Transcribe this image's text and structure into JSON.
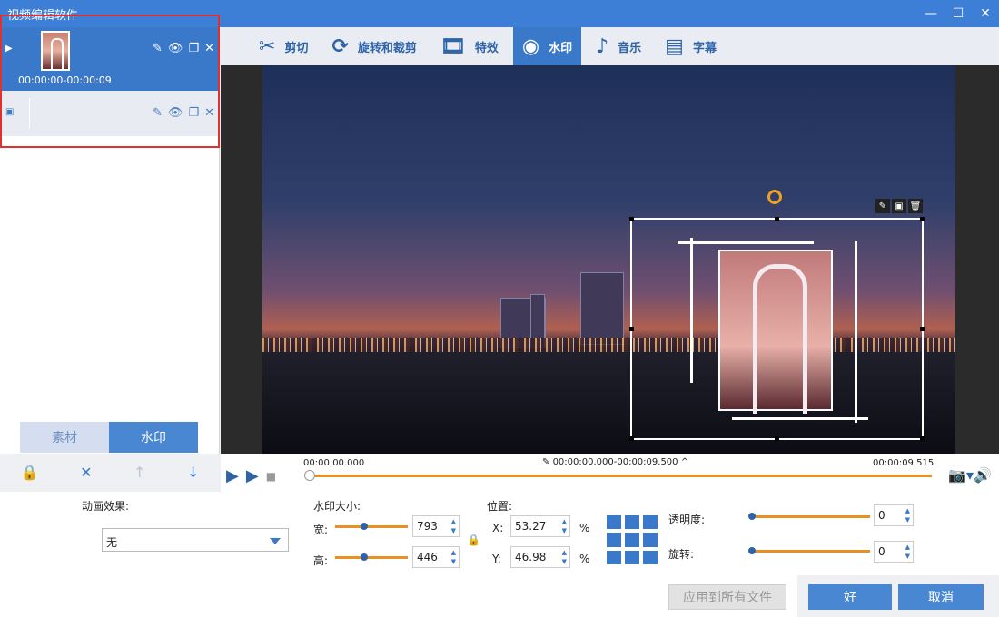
{
  "window": {
    "title": "视频编辑软件"
  },
  "clips": [
    {
      "time": "00:00:00-00:00:09"
    },
    {
      "time": ""
    }
  ],
  "left_tabs": {
    "material": "素材",
    "watermark": "水印"
  },
  "toolbar": {
    "items": [
      {
        "label": "剪切",
        "icon": "scissors-icon"
      },
      {
        "label": "旋转和裁剪",
        "icon": "crop-icon"
      },
      {
        "label": "特效",
        "icon": "effects-icon"
      },
      {
        "label": "水印",
        "icon": "watermark-icon"
      },
      {
        "label": "音乐",
        "icon": "music-icon"
      },
      {
        "label": "字幕",
        "icon": "subtitle-icon"
      }
    ],
    "active": "水印"
  },
  "timeline": {
    "start": "00:00:00.000",
    "range": "00:00:00.000-00:00:09.500",
    "end": "00:00:09.515",
    "progress": 0
  },
  "settings": {
    "animation_label": "动画效果:",
    "animation_value": "无",
    "size_label": "水印大小:",
    "width_label": "宽:",
    "width_value": "793",
    "height_label": "高:",
    "height_value": "446",
    "position_label": "位置:",
    "x_label": "X:",
    "x_value": "53.27",
    "y_label": "Y:",
    "y_value": "46.98",
    "percent": "%",
    "opacity_label": "透明度:",
    "opacity_value": "0",
    "rotate_label": "旋转:",
    "rotate_value": "0"
  },
  "buttons": {
    "apply_all": "应用到所有文件",
    "ok": "好",
    "cancel": "取消"
  }
}
